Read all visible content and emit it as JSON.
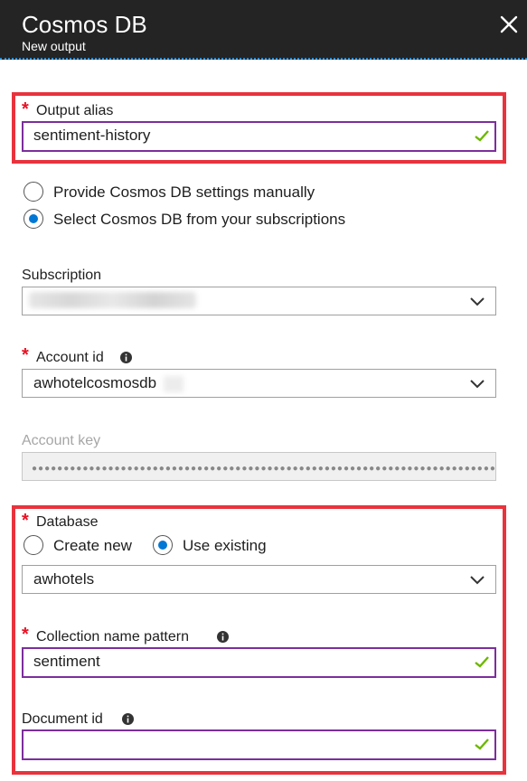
{
  "header": {
    "title": "Cosmos DB",
    "subtitle": "New output"
  },
  "output_alias": {
    "required_mark": "*",
    "label": "Output alias",
    "value": "sentiment-history"
  },
  "settings_mode": {
    "options": [
      {
        "label": "Provide Cosmos DB settings manually",
        "selected": false
      },
      {
        "label": "Select Cosmos DB from your subscriptions",
        "selected": true
      }
    ]
  },
  "subscription": {
    "label": "Subscription",
    "value": ""
  },
  "account_id": {
    "required_mark": "*",
    "label": "Account id",
    "value": "awhotelcosmosdb"
  },
  "account_key": {
    "label": "Account key",
    "value": "●●●●●●●●●●●●●●●●●●●●●●●●●●●●●●●●●●●●●●●●●●●●●●●●●●●●●●●●●●●●●●●●●●●●●●●●●●●"
  },
  "database": {
    "required_mark": "*",
    "label": "Database",
    "options": [
      {
        "label": "Create new",
        "selected": false
      },
      {
        "label": "Use existing",
        "selected": true
      }
    ],
    "value": "awhotels"
  },
  "collection_name_pattern": {
    "required_mark": "*",
    "label": "Collection name pattern",
    "value": "sentiment"
  },
  "document_id": {
    "label": "Document id",
    "value": ""
  },
  "colors": {
    "accent": "#0078d4",
    "highlight": "#e8333d",
    "valid_border": "#7c2e9c",
    "check": "#6bb700",
    "header_bg": "#242424"
  },
  "icons": [
    "close-icon",
    "checkmark-icon",
    "chevron-down-icon",
    "info-icon"
  ]
}
